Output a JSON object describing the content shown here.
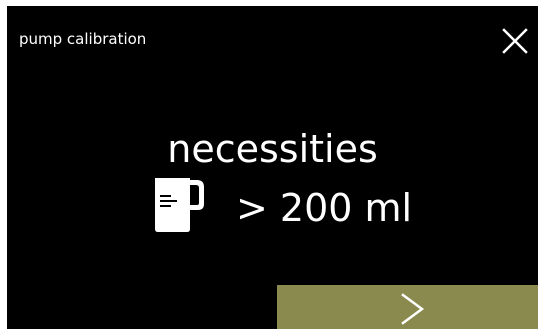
{
  "header": {
    "title": "pump calibration"
  },
  "main": {
    "requirement_text": "necessities",
    "amount_text": "> 200 ml"
  },
  "icons": {
    "close": "close-icon",
    "jug": "measuring-jug-icon",
    "next": "chevron-right-icon"
  },
  "colors": {
    "screen_background": "#000000",
    "text": "#ffffff",
    "next_button": "#8a8a4f"
  }
}
